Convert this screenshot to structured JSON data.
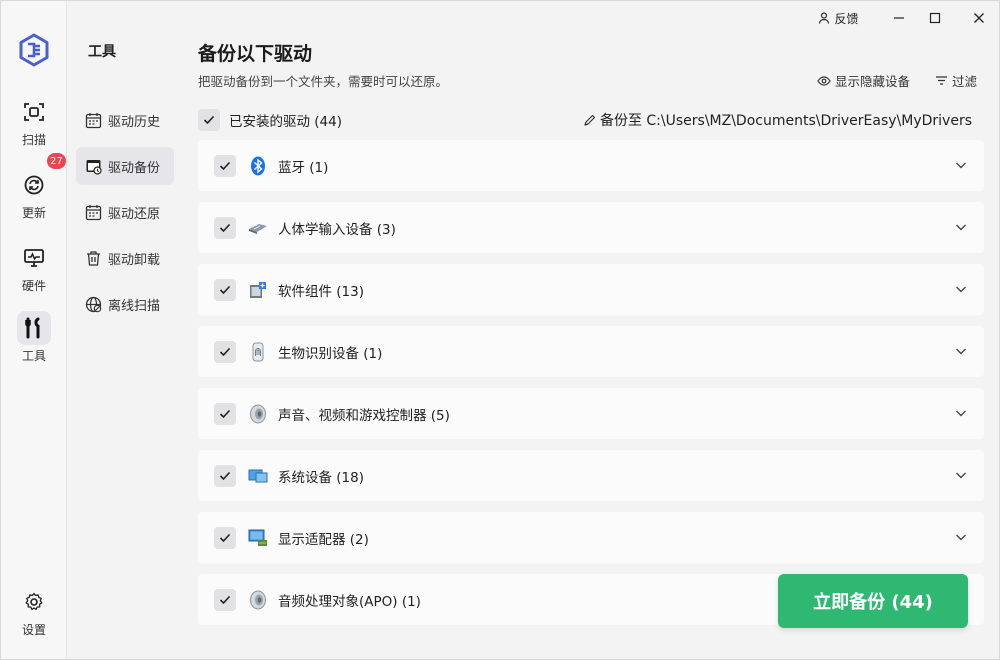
{
  "window": {
    "feedback_label": "反馈",
    "minimize_label": "minimize",
    "maximize_label": "maximize",
    "close_label": "close"
  },
  "rail": {
    "items": [
      {
        "label": "扫描",
        "icon": "scan-icon"
      },
      {
        "label": "更新",
        "icon": "refresh-icon",
        "badge": "27"
      },
      {
        "label": "硬件",
        "icon": "hardware-monitor-icon"
      },
      {
        "label": "工具",
        "icon": "tools-icon",
        "active": true
      }
    ],
    "settings_label": "设置"
  },
  "subnav": {
    "title": "工具",
    "items": [
      {
        "label": "驱动历史",
        "icon": "calendar-history-icon"
      },
      {
        "label": "驱动备份",
        "icon": "backup-icon",
        "active": true
      },
      {
        "label": "驱动还原",
        "icon": "restore-icon"
      },
      {
        "label": "驱动卸载",
        "icon": "trash-icon"
      },
      {
        "label": "离线扫描",
        "icon": "offline-globe-icon"
      }
    ]
  },
  "main": {
    "title": "备份以下驱动",
    "subtitle": "把驱动备份到一个文件夹，需要时可以还原。",
    "show_hidden_label": "显示隐藏设备",
    "filter_label": "过滤",
    "select_all_label": "已安装的驱动 (44)",
    "backup_path_label": "备份至 C:\\Users\\MZ\\Documents\\DriverEasy\\MyDrivers",
    "groups": [
      {
        "label": "蓝牙 (1)",
        "icon": "bluetooth-icon",
        "checked": true
      },
      {
        "label": "人体学输入设备 (3)",
        "icon": "hid-device-icon",
        "checked": true
      },
      {
        "label": "软件组件 (13)",
        "icon": "software-component-icon",
        "checked": true
      },
      {
        "label": "生物识别设备 (1)",
        "icon": "fingerprint-icon",
        "checked": true
      },
      {
        "label": "声音、视频和游戏控制器 (5)",
        "icon": "speaker-icon",
        "checked": true
      },
      {
        "label": "系统设备 (18)",
        "icon": "system-device-icon",
        "checked": true
      },
      {
        "label": "显示适配器 (2)",
        "icon": "display-adapter-icon",
        "checked": true
      },
      {
        "label": "音频处理对象(APO) (1)",
        "icon": "audio-apo-icon",
        "checked": true
      }
    ],
    "backup_button_label": "立即备份 (44)"
  },
  "colors": {
    "accent": "#2eb872",
    "badge": "#e5484d",
    "logo": "#4a5fd6"
  }
}
